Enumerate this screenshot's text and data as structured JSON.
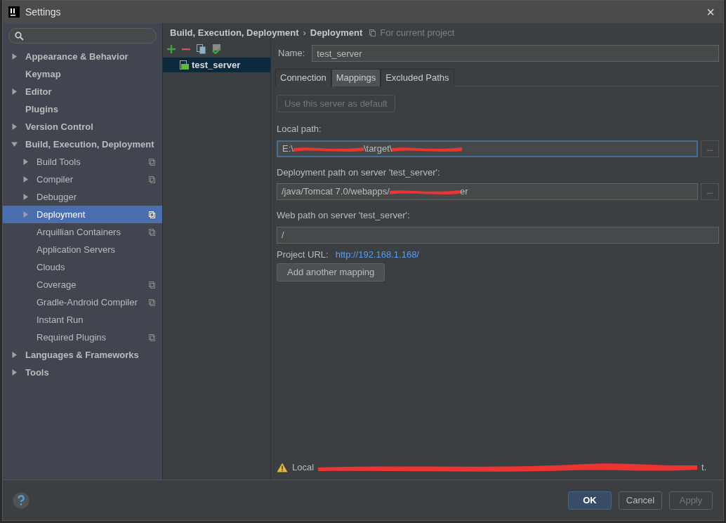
{
  "window": {
    "title": "Settings",
    "close": "×"
  },
  "sidebar": {
    "items": [
      {
        "label": "Appearance & Behavior",
        "kind": "collapsed",
        "project_level": false,
        "selected": false
      },
      {
        "label": "Keymap",
        "kind": "leaf",
        "project_level": false,
        "selected": false
      },
      {
        "label": "Editor",
        "kind": "collapsed",
        "project_level": false,
        "selected": false
      },
      {
        "label": "Plugins",
        "kind": "leaf",
        "project_level": false,
        "selected": false
      },
      {
        "label": "Version Control",
        "kind": "collapsed",
        "project_level": false,
        "selected": false
      },
      {
        "label": "Build, Execution, Deployment",
        "kind": "expanded",
        "project_level": false,
        "selected": false,
        "children": [
          {
            "label": "Build Tools",
            "kind": "collapsed",
            "project_level": true,
            "selected": false
          },
          {
            "label": "Compiler",
            "kind": "collapsed",
            "project_level": true,
            "selected": false
          },
          {
            "label": "Debugger",
            "kind": "collapsed",
            "project_level": false,
            "selected": false
          },
          {
            "label": "Deployment",
            "kind": "collapsed",
            "project_level": true,
            "selected": true
          },
          {
            "label": "Arquillian Containers",
            "kind": "leaf",
            "project_level": true,
            "selected": false
          },
          {
            "label": "Application Servers",
            "kind": "leaf",
            "project_level": false,
            "selected": false
          },
          {
            "label": "Clouds",
            "kind": "leaf",
            "project_level": false,
            "selected": false
          },
          {
            "label": "Coverage",
            "kind": "leaf",
            "project_level": true,
            "selected": false
          },
          {
            "label": "Gradle-Android Compiler",
            "kind": "leaf",
            "project_level": true,
            "selected": false
          },
          {
            "label": "Instant Run",
            "kind": "leaf",
            "project_level": false,
            "selected": false
          },
          {
            "label": "Required Plugins",
            "kind": "leaf",
            "project_level": true,
            "selected": false
          }
        ]
      },
      {
        "label": "Languages & Frameworks",
        "kind": "collapsed",
        "project_level": false,
        "selected": false
      },
      {
        "label": "Tools",
        "kind": "collapsed",
        "project_level": false,
        "selected": false
      }
    ]
  },
  "breadcrumb": {
    "parent": "Build, Execution, Deployment",
    "separator": "›",
    "current": "Deployment",
    "scope": "For current project"
  },
  "servers": [
    {
      "name": "test_server",
      "selected": true
    }
  ],
  "name_field": {
    "label": "Name:",
    "value": "test_server"
  },
  "tabs": [
    {
      "label": "Connection",
      "selected": false
    },
    {
      "label": "Mappings",
      "selected": true
    },
    {
      "label": "Excluded Paths",
      "selected": false
    }
  ],
  "default_button": {
    "label": "Use this server as default",
    "disabled": true
  },
  "local_path": {
    "label": "Local path:",
    "focused": true,
    "segments": [
      {
        "kind": "text",
        "text": "E:\\"
      },
      {
        "kind": "redacted"
      },
      {
        "kind": "text",
        "text": "\\target\\"
      },
      {
        "kind": "redacted"
      }
    ],
    "browse": "..."
  },
  "deployment_path": {
    "label": "Deployment path on server 'test_server':",
    "focused": false,
    "segments": [
      {
        "kind": "text",
        "text": "/java/Tomcat 7.0/webapps/"
      },
      {
        "kind": "redacted"
      },
      {
        "kind": "text",
        "text": "er"
      }
    ],
    "browse": "..."
  },
  "web_path": {
    "label": "Web path on server 'test_server':",
    "value": "/"
  },
  "project_url": {
    "label": "Project URL:",
    "link": "http://192.168.1.168/"
  },
  "add_mapping_button": "Add another mapping",
  "warning": {
    "segments": [
      {
        "kind": "text",
        "text": "Local"
      },
      {
        "kind": "redacted"
      },
      {
        "kind": "text",
        "text": "t."
      }
    ]
  },
  "buttons": [
    {
      "label": "OK",
      "kind": "default",
      "disabled": false
    },
    {
      "label": "Cancel",
      "kind": "normal",
      "disabled": false
    },
    {
      "label": "Apply",
      "kind": "normal",
      "disabled": true
    }
  ]
}
